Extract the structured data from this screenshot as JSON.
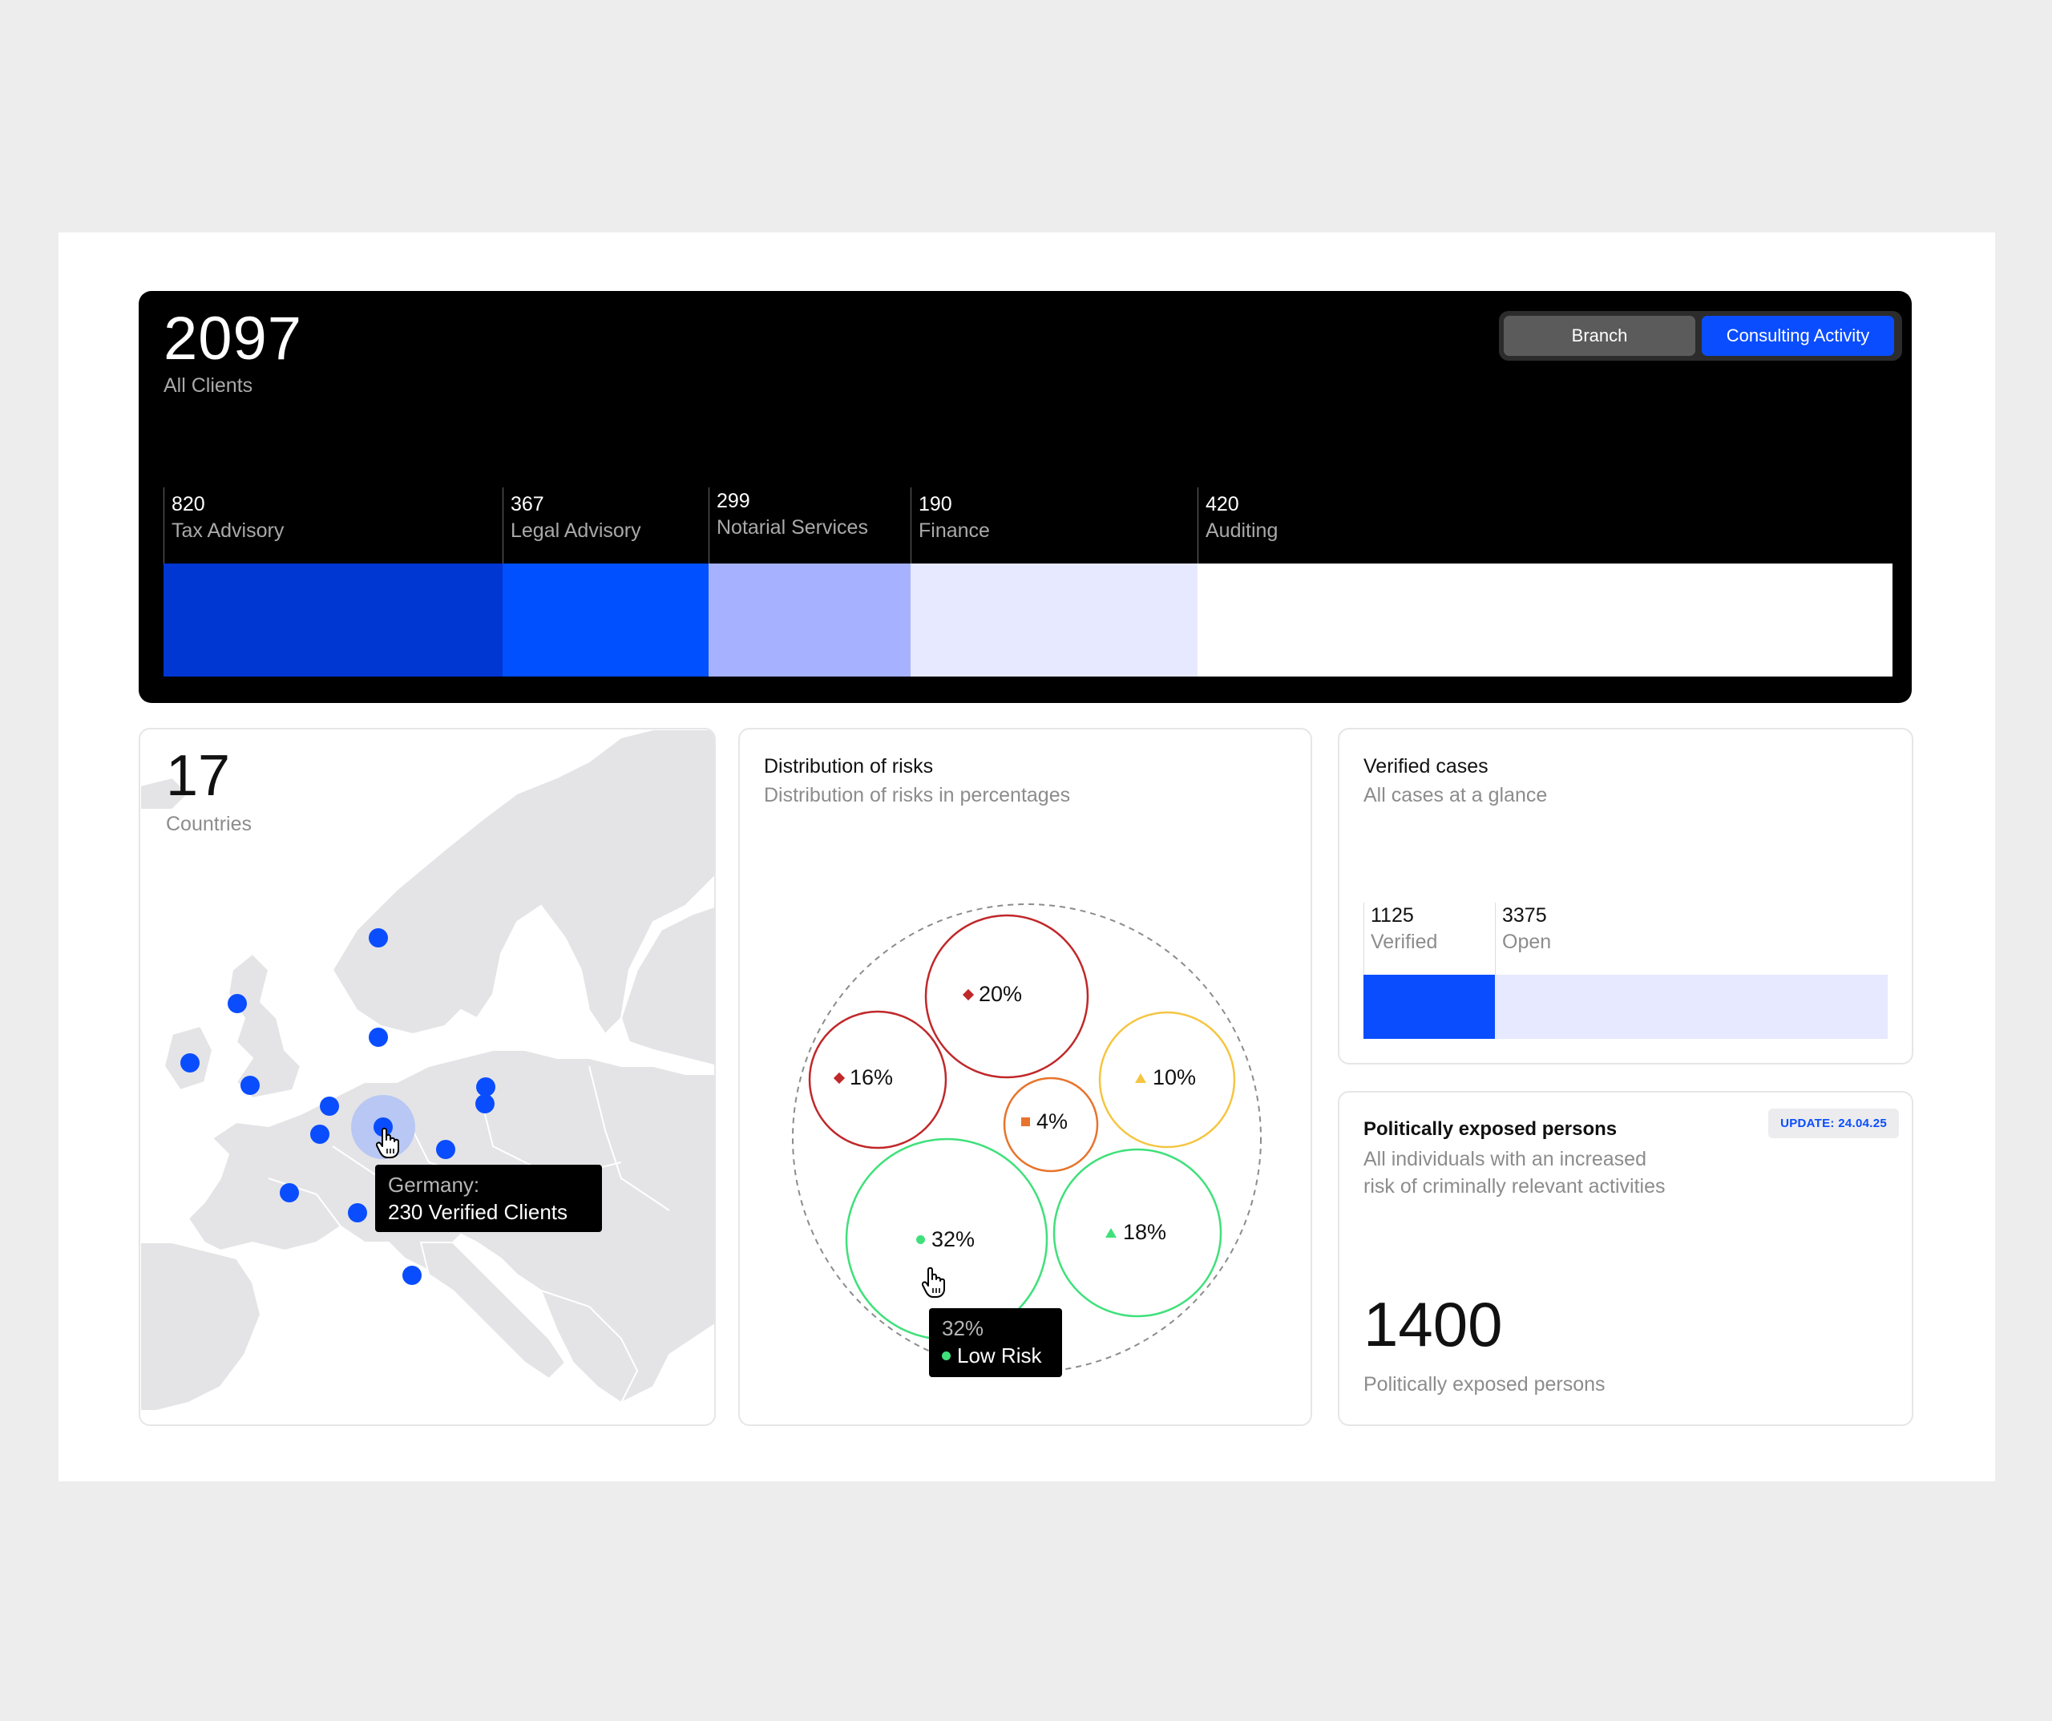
{
  "summary": {
    "total": "2097",
    "total_label": "All Clients",
    "toggle": {
      "branch": "Branch",
      "activity": "Consulting Activity",
      "active": "activity"
    },
    "segments": [
      {
        "count": "820",
        "label": "Tax Advisory",
        "value": 820,
        "color": "#0036d1"
      },
      {
        "count": "367",
        "label": "Legal Advisory",
        "value": 367,
        "color": "#0050ff"
      },
      {
        "count": "299",
        "label": "Notarial Services",
        "value": 299,
        "color": "#a6b2ff"
      },
      {
        "count": "190",
        "label": "Finance",
        "value": 190,
        "color": "#e6e9ff"
      },
      {
        "count": "420",
        "label": "Auditing",
        "value": 420,
        "color": "#ffffff"
      }
    ]
  },
  "countries": {
    "count": "17",
    "label": "Countries",
    "tooltip": {
      "country": "Germany:",
      "value": "230 Verified Clients"
    }
  },
  "risks": {
    "title": "Distribution of risks",
    "subtitle": "Distribution of risks in percentages",
    "bubbles": [
      {
        "label": "20%",
        "marker": "diamond",
        "color": "#c0282a"
      },
      {
        "label": "16%",
        "marker": "diamond",
        "color": "#c0282a"
      },
      {
        "label": "10%",
        "marker": "triangle",
        "color": "#f5c542"
      },
      {
        "label": "4%",
        "marker": "square",
        "color": "#e8732c"
      },
      {
        "label": "32%",
        "marker": "dot",
        "color": "#3fe07a"
      },
      {
        "label": "18%",
        "marker": "triangle",
        "color": "#3fe07a"
      }
    ],
    "tooltip": {
      "value": "32%",
      "label": "Low Risk"
    }
  },
  "verified": {
    "title": "Verified cases",
    "subtitle": "All cases at a glance",
    "items": [
      {
        "count": "1125",
        "label": "Verified",
        "value": 1125,
        "color": "#0a4dff"
      },
      {
        "count": "3375",
        "label": "Open",
        "value": 3375,
        "color": "#e6e9ff"
      }
    ]
  },
  "pep": {
    "title": "Politically exposed persons",
    "subtitle_line1": "All individuals with an increased",
    "subtitle_line2": "risk of criminally relevant activities",
    "badge": "UPDATE: 24.04.25",
    "count": "1400",
    "count_label": "Politically exposed persons"
  },
  "colors": {
    "accent": "#0a4dff",
    "panel": "#000000"
  }
}
